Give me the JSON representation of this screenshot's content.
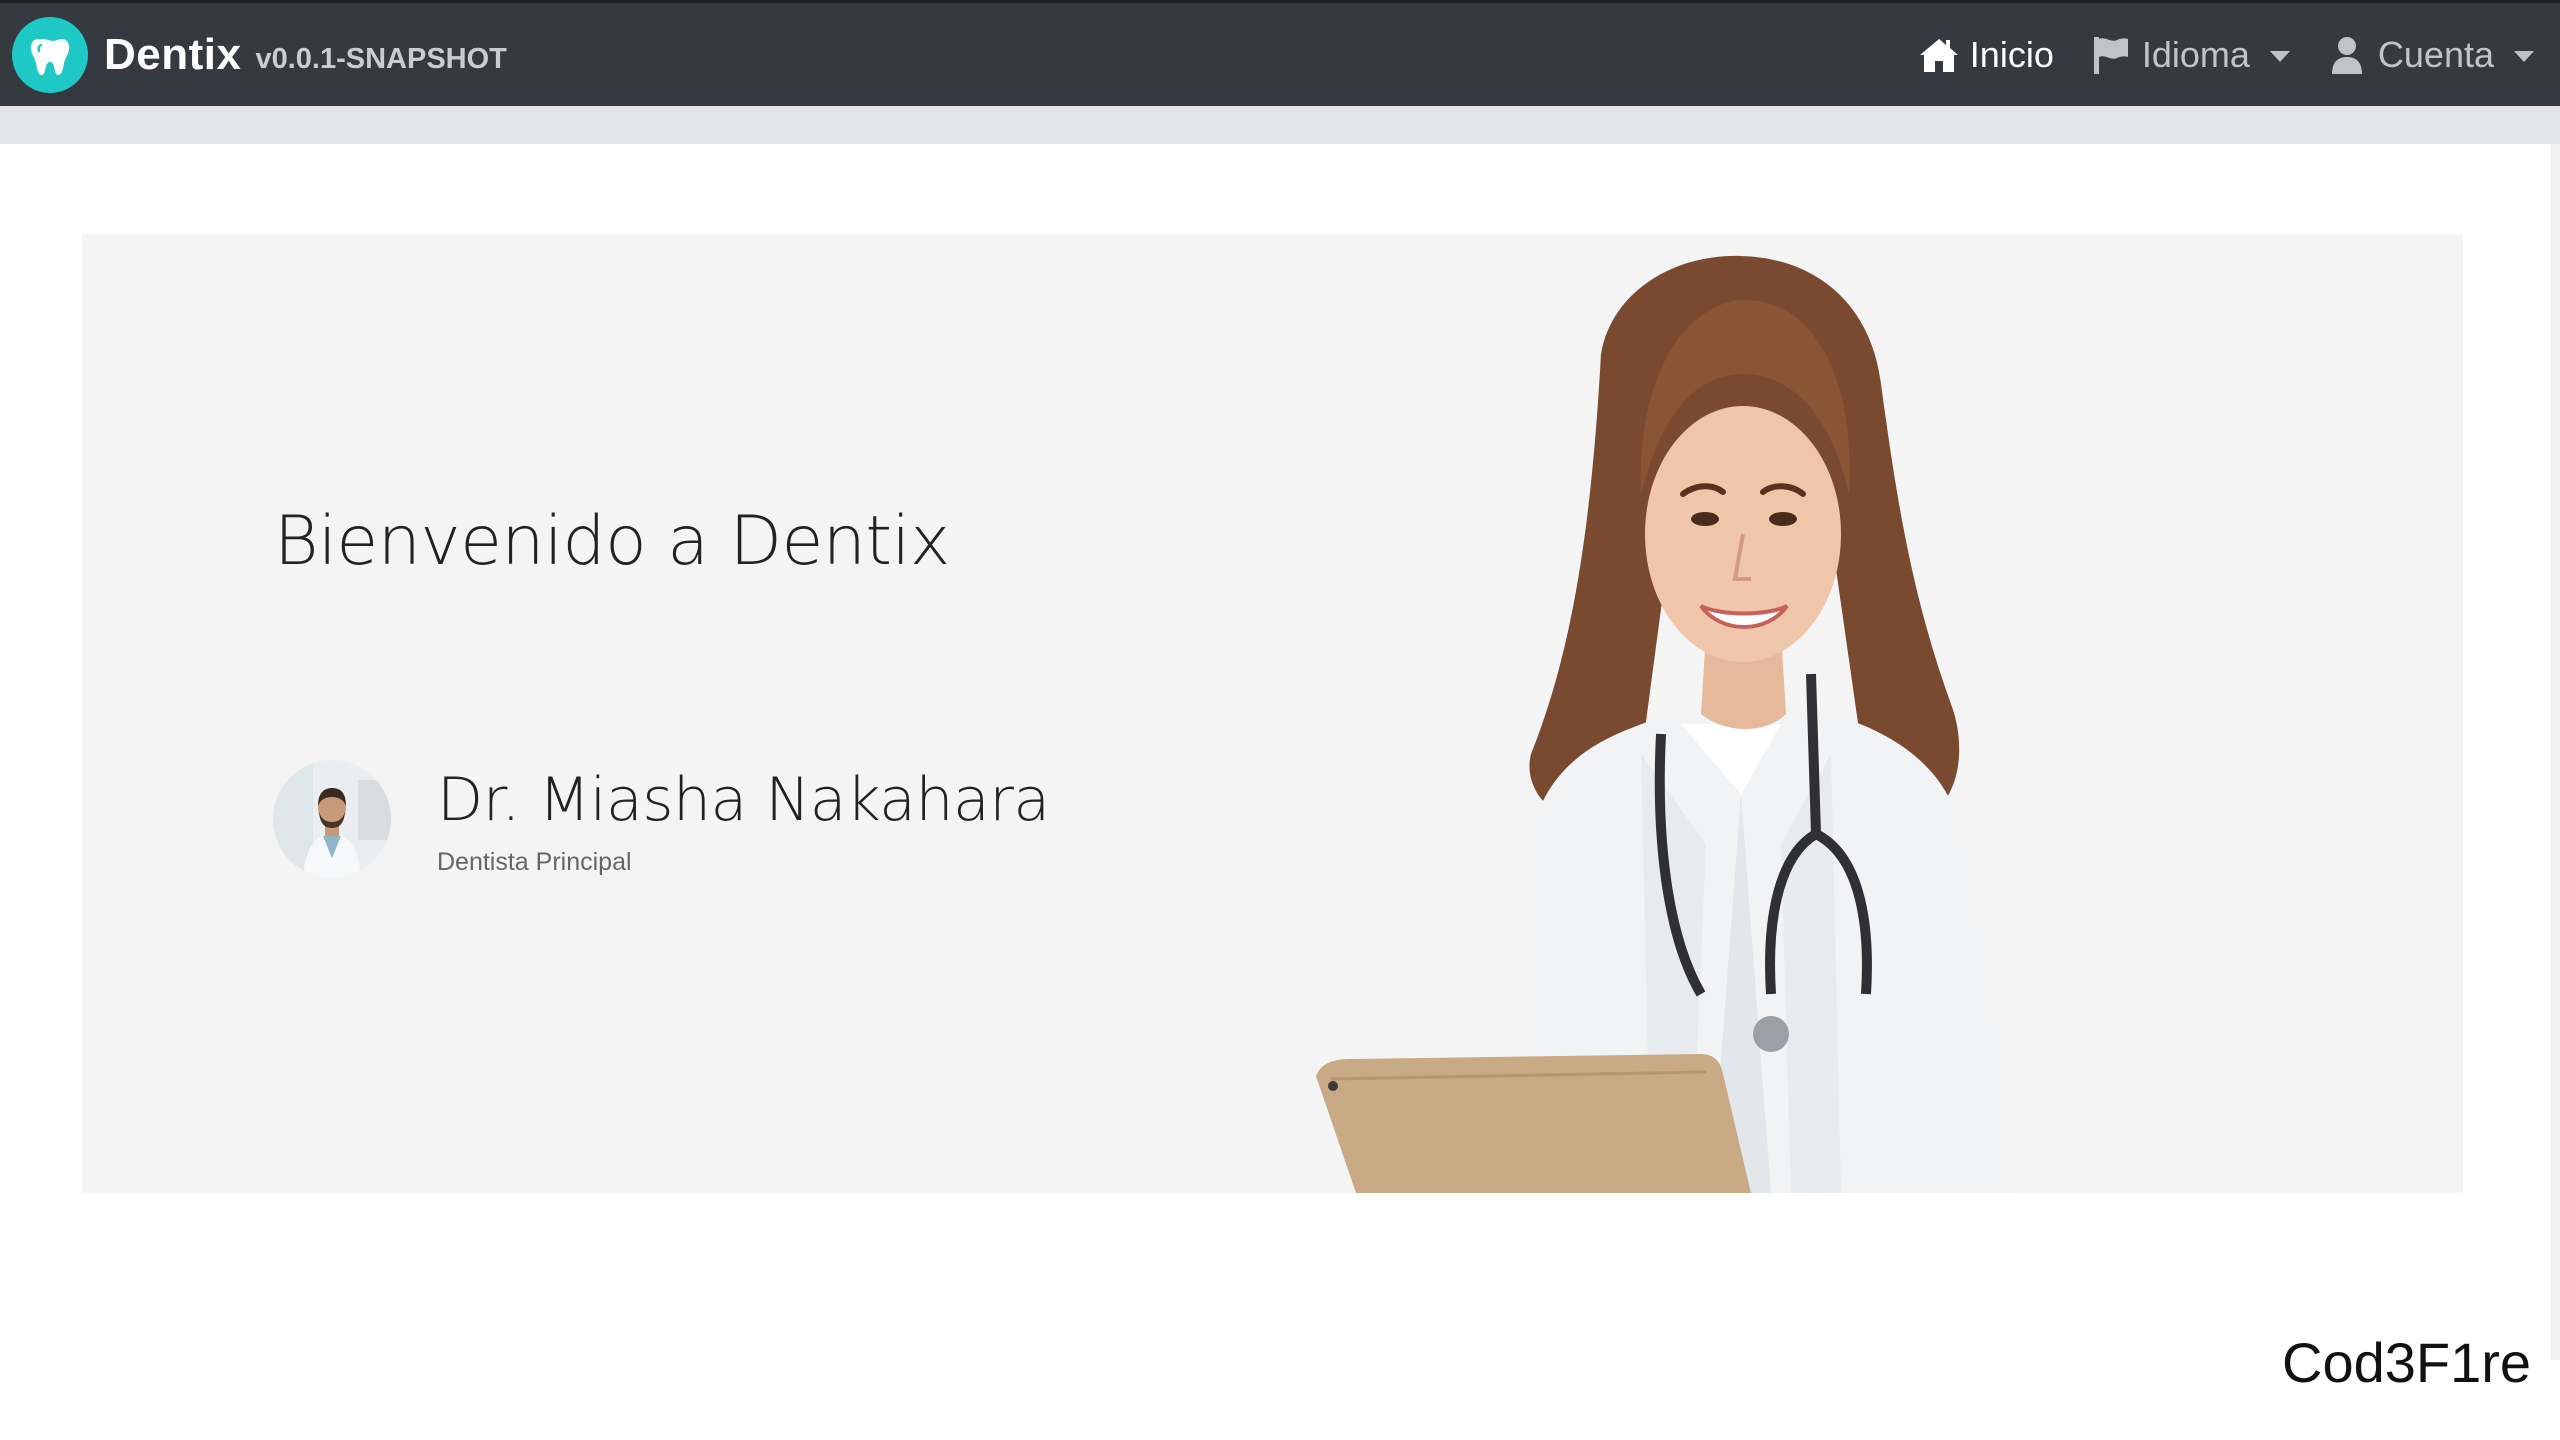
{
  "navbar": {
    "brand_name": "Dentix",
    "version": "v0.0.1-SNAPSHOT",
    "items": [
      {
        "label": "Inicio",
        "icon": "home-icon",
        "active": true
      },
      {
        "label": "Idioma",
        "icon": "flag-icon",
        "dropdown": true
      },
      {
        "label": "Cuenta",
        "icon": "user-icon",
        "dropdown": true
      }
    ],
    "colors": {
      "bar": "#343a40",
      "logo": "#1ec8c5"
    }
  },
  "hero": {
    "title": "Bienvenido a Dentix",
    "doctor_name": "Dr. Miasha Nakahara",
    "doctor_role": "Dentista Principal",
    "background": "#f4f4f4"
  },
  "watermark": "Cod3F1re"
}
